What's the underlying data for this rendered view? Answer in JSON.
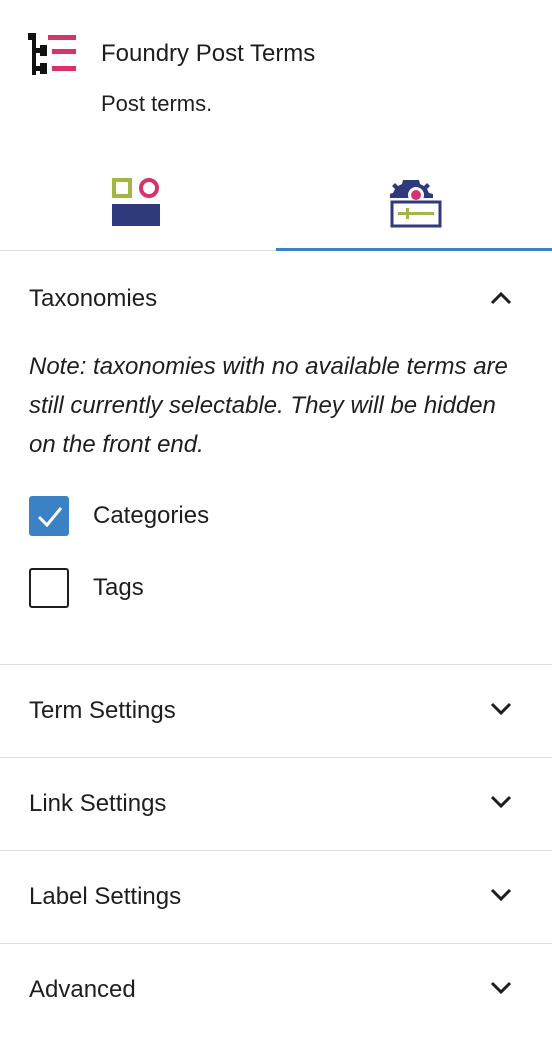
{
  "block": {
    "title": "Foundry Post Terms",
    "description": "Post terms.",
    "icon": "foundry-post-terms-icon"
  },
  "tabs": [
    {
      "name": "styles",
      "icon": "styles-icon",
      "active": false
    },
    {
      "name": "settings",
      "icon": "settings-icon",
      "active": true
    }
  ],
  "taxonomies": {
    "title": "Taxonomies",
    "expanded": true,
    "note": "Note: taxonomies with no available terms are still currently selectable. They will be hidden on the front end.",
    "options": [
      {
        "label": "Categories",
        "checked": true
      },
      {
        "label": "Tags",
        "checked": false
      }
    ]
  },
  "panels": [
    {
      "title": "Term Settings",
      "expanded": false
    },
    {
      "title": "Link Settings",
      "expanded": false
    },
    {
      "title": "Label Settings",
      "expanded": false
    },
    {
      "title": "Advanced",
      "expanded": false
    }
  ],
  "colors": {
    "accent": "#3b82c4",
    "brand_pink": "#d6336c",
    "brand_navy": "#2e3a7c",
    "brand_green": "#a4b545",
    "divider": "#dddddd"
  }
}
